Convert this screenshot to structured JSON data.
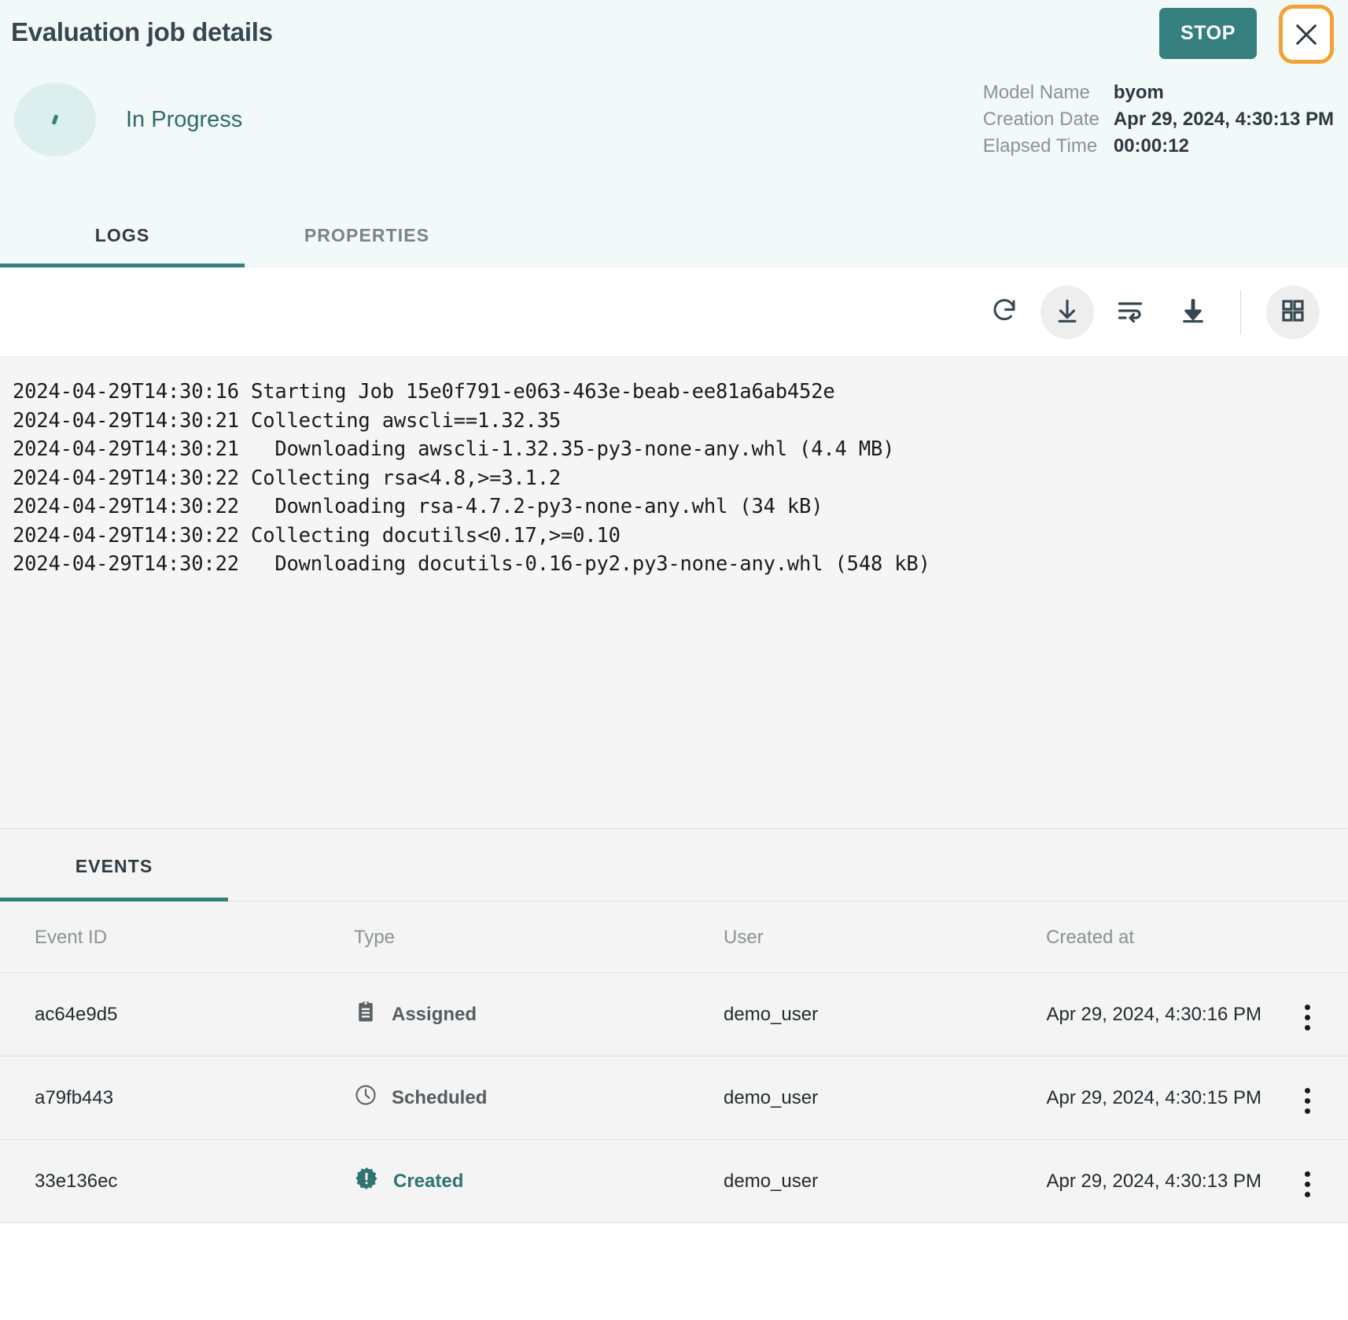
{
  "header": {
    "title": "Evaluation job details",
    "stop_label": "STOP",
    "close_icon": "close-icon",
    "status": "In Progress",
    "meta": [
      {
        "key": "Model Name",
        "value": "byom"
      },
      {
        "key": "Creation Date",
        "value": "Apr 29, 2024, 4:30:13 PM"
      },
      {
        "key": "Elapsed Time",
        "value": "00:00:12"
      }
    ],
    "tabs": [
      {
        "label": "LOGS",
        "active": true
      },
      {
        "label": "PROPERTIES",
        "active": false
      }
    ]
  },
  "log_toolbar": {
    "buttons": [
      {
        "icon": "refresh-icon",
        "filled": false
      },
      {
        "icon": "scroll-bottom-icon",
        "filled": true
      },
      {
        "icon": "wrap-text-icon",
        "filled": false
      },
      {
        "icon": "download-icon",
        "filled": false
      },
      {
        "icon": "grid-view-icon",
        "filled": true
      }
    ]
  },
  "logs": {
    "lines": [
      "2024-04-29T14:30:16 Starting Job 15e0f791-e063-463e-beab-ee81a6ab452e",
      "2024-04-29T14:30:21 Collecting awscli==1.32.35",
      "2024-04-29T14:30:21   Downloading awscli-1.32.35-py3-none-any.whl (4.4 MB)",
      "2024-04-29T14:30:22 Collecting rsa<4.8,>=3.1.2",
      "2024-04-29T14:30:22   Downloading rsa-4.7.2-py3-none-any.whl (34 kB)",
      "2024-04-29T14:30:22 Collecting docutils<0.17,>=0.10",
      "2024-04-29T14:30:22   Downloading docutils-0.16-py2.py3-none-any.whl (548 kB)"
    ]
  },
  "events": {
    "tab_label": "EVENTS",
    "columns": [
      "Event ID",
      "Type",
      "User",
      "Created at"
    ],
    "rows": [
      {
        "id": "ac64e9d5",
        "type": "Assigned",
        "type_icon": "clipboard-icon",
        "accent": false,
        "user": "demo_user",
        "created_at": "Apr 29, 2024, 4:30:16 PM"
      },
      {
        "id": "a79fb443",
        "type": "Scheduled",
        "type_icon": "clock-icon",
        "accent": false,
        "user": "demo_user",
        "created_at": "Apr 29, 2024, 4:30:15 PM"
      },
      {
        "id": "33e136ec",
        "type": "Created",
        "type_icon": "badge-exclamation-icon",
        "accent": true,
        "user": "demo_user",
        "created_at": "Apr 29, 2024, 4:30:13 PM"
      }
    ]
  },
  "colors": {
    "accent_teal": "#35807e",
    "header_bg": "#f2f9f9",
    "highlight_orange": "#f5a033",
    "log_bg": "#f5f5f5",
    "muted_text": "#8b9397"
  }
}
